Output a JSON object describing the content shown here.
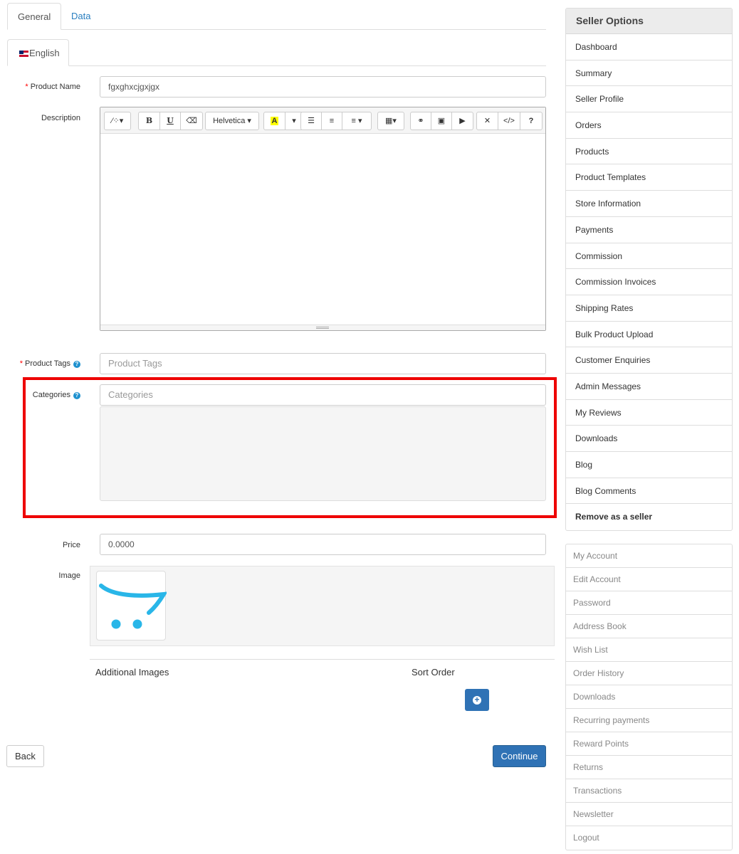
{
  "tabs": {
    "general": "General",
    "data": "Data"
  },
  "language_tab": "English",
  "form": {
    "product_name": {
      "label": "Product Name",
      "value": "fgxghxcjgxjgx"
    },
    "description": {
      "label": "Description"
    },
    "toolbar": {
      "magic": "⁄⁘▾",
      "bold": "B",
      "underline": "U",
      "eraser": "⌫",
      "font": "Helvetica ▾",
      "color": "A",
      "color_caret": "▾",
      "ul": "☰",
      "ol": "≡",
      "align": "≡ ▾",
      "table": "▦▾",
      "link": "⚭",
      "picture": "▣",
      "video": "▶",
      "fullscreen": "✕",
      "code": "</>",
      "help": "?"
    },
    "product_tags": {
      "label": "Product Tags",
      "placeholder": "Product Tags"
    },
    "categories": {
      "label": "Categories",
      "placeholder": "Categories"
    },
    "price": {
      "label": "Price",
      "value": "0.0000"
    },
    "image": {
      "label": "Image"
    },
    "additional_images": {
      "col_image": "Additional Images",
      "col_sort": "Sort Order"
    },
    "help_glyph": "?"
  },
  "buttons": {
    "back": "Back",
    "continue": "Continue"
  },
  "seller_options": {
    "title": "Seller Options",
    "items": [
      "Dashboard",
      "Summary",
      "Seller Profile",
      "Orders",
      "Products",
      "Product Templates",
      "Store Information",
      "Payments",
      "Commission",
      "Commission Invoices",
      "Shipping Rates",
      "Bulk Product Upload",
      "Customer Enquiries",
      "Admin Messages",
      "My Reviews",
      "Downloads",
      "Blog",
      "Blog Comments",
      "Remove as a seller"
    ]
  },
  "account_menu": {
    "items": [
      "My Account",
      "Edit Account",
      "Password",
      "Address Book",
      "Wish List",
      "Order History",
      "Downloads",
      "Recurring payments",
      "Reward Points",
      "Returns",
      "Transactions",
      "Newsletter",
      "Logout"
    ]
  },
  "colors": {
    "primary": "#2f72b5",
    "highlight_box": "#ee0000",
    "logo_cyan": "#29b6e8",
    "required": "#ff0000"
  }
}
